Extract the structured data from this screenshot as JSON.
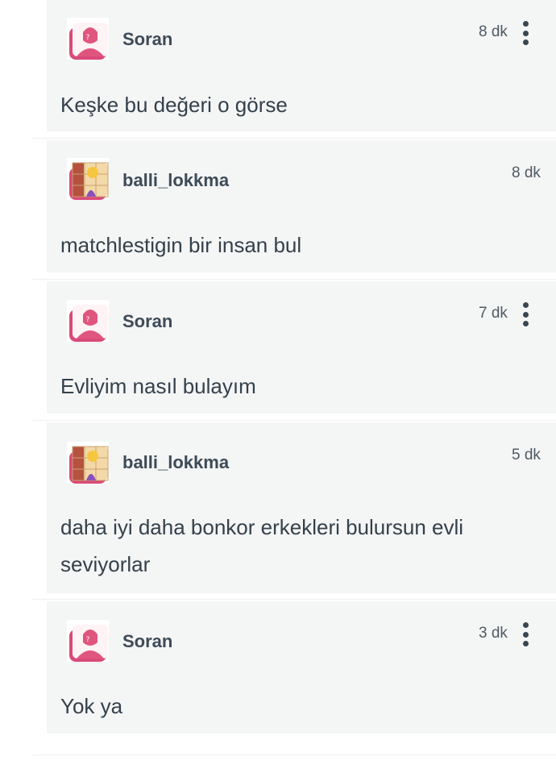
{
  "comments": [
    {
      "user": "Soran",
      "avatar": "anonymous-woman-avatar",
      "time": "8 dk",
      "text": "Keşke bu değeri o görse",
      "has_menu": true
    },
    {
      "user": "balli_lokkma",
      "avatar": "user-photo-avatar",
      "time": "8 dk",
      "text": "matchlestigin bir insan bul",
      "has_menu": false
    },
    {
      "user": "Soran",
      "avatar": "anonymous-woman-avatar",
      "time": "7 dk",
      "text": "Evliyim nasıl bulayım",
      "has_menu": true
    },
    {
      "user": "balli_lokkma",
      "avatar": "user-photo-avatar",
      "time": "5 dk",
      "text": "daha iyi daha bonkor erkekleri bulursun evli seviyorlar",
      "has_menu": false
    },
    {
      "user": "Soran",
      "avatar": "anonymous-woman-avatar",
      "time": "3 dk",
      "text": "Yok ya",
      "has_menu": true
    }
  ],
  "colors": {
    "card_bg": "#f4f5f5",
    "accent_pink": "#e0557e",
    "text": "#34414c"
  }
}
